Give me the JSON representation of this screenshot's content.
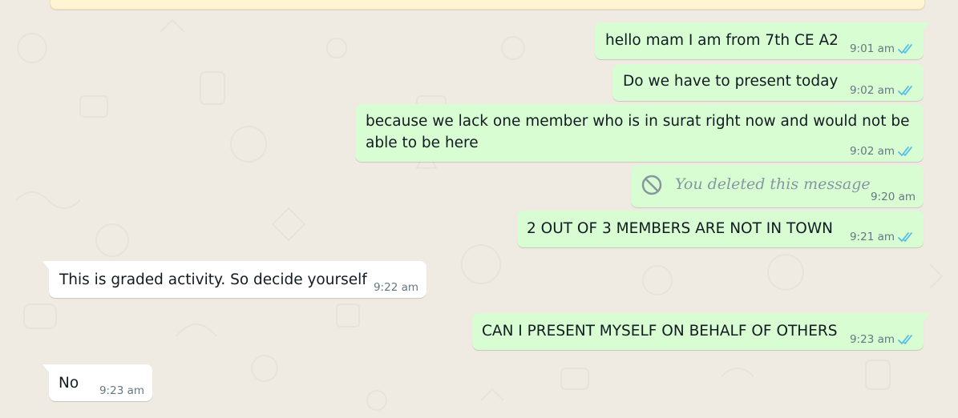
{
  "colors": {
    "background": "#efeae2",
    "outgoing_bubble": "#d9fdd3",
    "incoming_bubble": "#ffffff",
    "banner": "#fff5d3",
    "timestamp": "#667781",
    "read_ticks": "#53bdeb",
    "deleted_text": "#8696a0"
  },
  "icons": {
    "read_receipt": "double-check-icon",
    "deleted": "prohibited-icon"
  },
  "messages": [
    {
      "direction": "out",
      "text": "hello mam I am from 7th CE A2",
      "time": "9:01 am",
      "status": "read"
    },
    {
      "direction": "out",
      "text": "Do we have to present today",
      "time": "9:02 am",
      "status": "read"
    },
    {
      "direction": "out",
      "text": "because we lack one member who is in surat right now and would not be able to be here",
      "time": "9:02 am",
      "status": "read"
    },
    {
      "direction": "out",
      "text": "You deleted this message",
      "time": "9:20 am",
      "deleted": true
    },
    {
      "direction": "out",
      "text": "2 OUT OF 3 MEMBERS ARE NOT IN TOWN",
      "time": "9:21 am",
      "status": "read"
    },
    {
      "direction": "in",
      "text": "This is graded activity. So decide yourself",
      "time": "9:22 am"
    },
    {
      "direction": "out",
      "text": "CAN I PRESENT MYSELF ON BEHALF OF OTHERS",
      "time": "9:23 am",
      "status": "read"
    },
    {
      "direction": "in",
      "text": "No",
      "time": "9:23 am"
    }
  ]
}
